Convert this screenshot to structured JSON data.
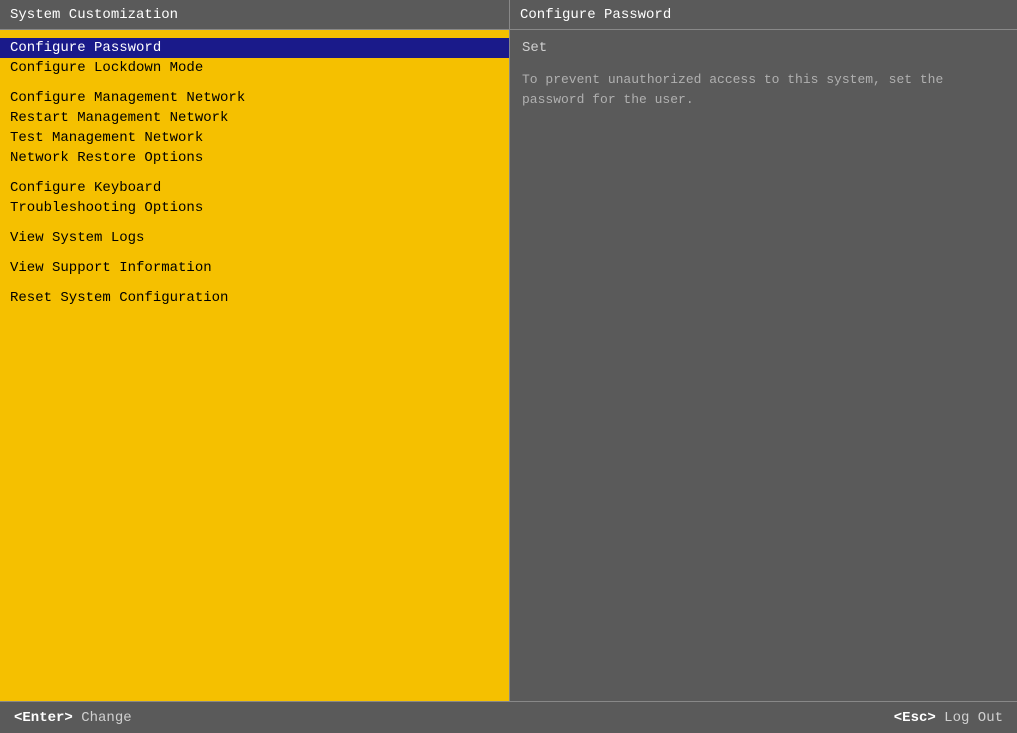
{
  "header": {
    "left_title": "System Customization",
    "right_title": "Configure Password"
  },
  "menu": {
    "items": [
      {
        "label": "Configure Password",
        "selected": true,
        "spacer_before": false
      },
      {
        "label": "Configure Lockdown Mode",
        "selected": false,
        "spacer_before": false
      },
      {
        "label": "",
        "selected": false,
        "spacer_before": false,
        "is_spacer": true
      },
      {
        "label": "Configure Management Network",
        "selected": false,
        "spacer_before": false
      },
      {
        "label": "Restart Management Network",
        "selected": false,
        "spacer_before": false
      },
      {
        "label": "Test Management Network",
        "selected": false,
        "spacer_before": false
      },
      {
        "label": "Network Restore Options",
        "selected": false,
        "spacer_before": false
      },
      {
        "label": "",
        "selected": false,
        "is_spacer": true
      },
      {
        "label": "Configure Keyboard",
        "selected": false,
        "spacer_before": false
      },
      {
        "label": "Troubleshooting Options",
        "selected": false,
        "spacer_before": false
      },
      {
        "label": "",
        "selected": false,
        "is_spacer": true
      },
      {
        "label": "View System Logs",
        "selected": false,
        "spacer_before": false
      },
      {
        "label": "",
        "selected": false,
        "is_spacer": true
      },
      {
        "label": "View Support Information",
        "selected": false,
        "spacer_before": false
      },
      {
        "label": "",
        "selected": false,
        "is_spacer": true
      },
      {
        "label": "Reset System Configuration",
        "selected": false,
        "spacer_before": false
      }
    ]
  },
  "detail": {
    "title": "Set",
    "description": "To prevent unauthorized access to this system, set the\npassword for the user."
  },
  "footer": {
    "enter_key": "<Enter>",
    "enter_action": " Change",
    "esc_key": "<Esc>",
    "esc_action": " Log Out"
  }
}
